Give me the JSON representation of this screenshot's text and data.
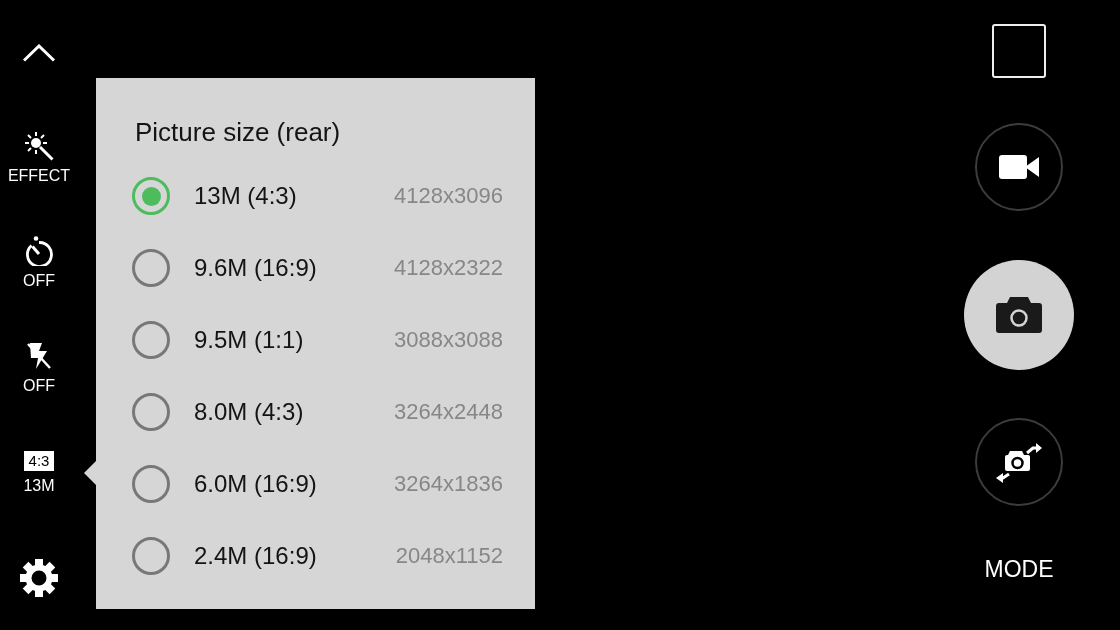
{
  "sidebar": {
    "items": [
      {
        "kind": "collapse",
        "selected": false
      },
      {
        "kind": "effect",
        "label": "EFFECT",
        "selected": false
      },
      {
        "kind": "timer",
        "label": "OFF",
        "selected": false
      },
      {
        "kind": "flash",
        "label": "OFF",
        "selected": false
      },
      {
        "kind": "picture_size",
        "badge": "4:3",
        "label": "13M",
        "selected": true
      },
      {
        "kind": "settings",
        "selected": false
      }
    ]
  },
  "popup": {
    "title": "Picture size (rear)",
    "options": [
      {
        "label": "13M (4:3)",
        "resolution": "4128x3096",
        "selected": true
      },
      {
        "label": "9.6M (16:9)",
        "resolution": "4128x2322",
        "selected": false
      },
      {
        "label": "9.5M (1:1)",
        "resolution": "3088x3088",
        "selected": false
      },
      {
        "label": "8.0M (4:3)",
        "resolution": "3264x2448",
        "selected": false
      },
      {
        "label": "6.0M (16:9)",
        "resolution": "3264x1836",
        "selected": false
      },
      {
        "label": "2.4M (16:9)",
        "resolution": "2048x1152",
        "selected": false
      }
    ]
  },
  "camera_controls": [
    {
      "kind": "gallery"
    },
    {
      "kind": "video"
    },
    {
      "kind": "capture"
    },
    {
      "kind": "switch_camera"
    }
  ],
  "mode_button": {
    "label": "MODE"
  }
}
